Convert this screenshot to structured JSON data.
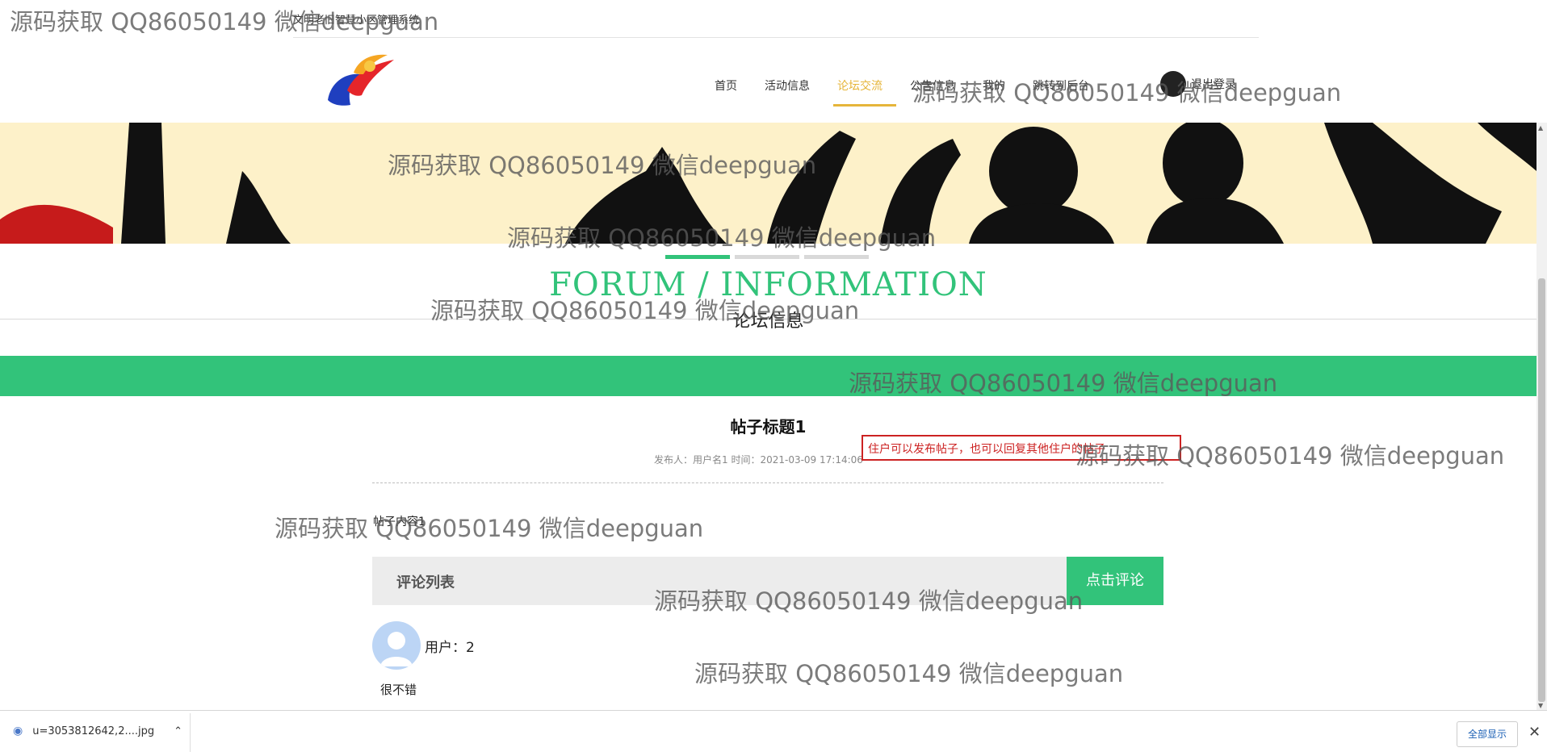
{
  "site": {
    "title": "文明老旧智慧小区管理系统"
  },
  "nav": {
    "items": [
      "首页",
      "活动信息",
      "论坛交流",
      "公告信息",
      "我的",
      "跳转到后台"
    ],
    "active_index": 2,
    "user_label": "退出登录"
  },
  "section": {
    "title_en": "FORUM / INFORMATION",
    "title_cn": "论坛信息"
  },
  "post": {
    "title": "帖子标题1",
    "meta": "发布人：用户名1 时间：2021-03-09 17:14:06",
    "content": "帖子内容1"
  },
  "tip": "住户可以发布帖子，也可以回复其他住户的帖子",
  "comments": {
    "header": "评论列表",
    "button": "点击评论",
    "items": [
      {
        "user": "用户：2",
        "text": "很不错"
      }
    ]
  },
  "download": {
    "filename": "u=3053812642,2....jpg",
    "show_all": "全部显示"
  },
  "watermark": "源码获取 QQ86050149 微信deepguan",
  "colors": {
    "accent": "#32c37a",
    "nav_active": "#e6b53a",
    "tip": "#cc2222"
  }
}
